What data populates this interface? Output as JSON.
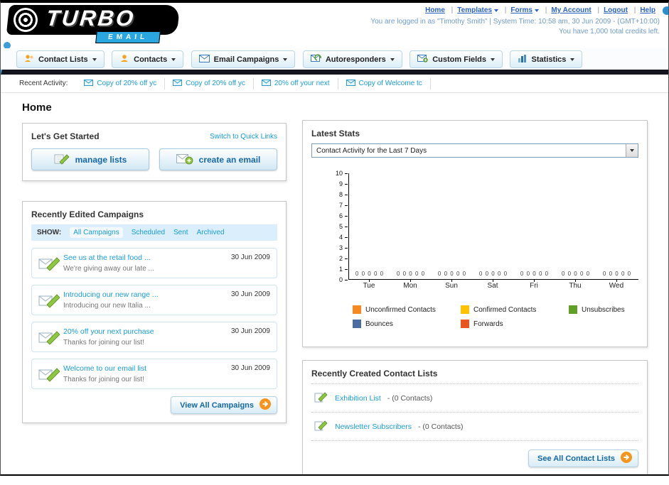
{
  "page_title": "Home",
  "header": {
    "logo_main": "TURBO",
    "logo_sub": "EMAIL",
    "top_links": [
      "Home",
      "Templates",
      "Forms",
      "My Account",
      "Logout",
      "Help"
    ],
    "login_info": "You are logged in as \"Timothy Smith\" | System Time: 10:58 am, 30 Jun 2009 - (GMT+10:00)",
    "credits_info": "You have 1,000 total credits left."
  },
  "nav": {
    "tabs": [
      {
        "label": "Contact Lists"
      },
      {
        "label": "Contacts"
      },
      {
        "label": "Email Campaigns"
      },
      {
        "label": "Autoresponders"
      },
      {
        "label": "Custom Fields"
      },
      {
        "label": "Statistics"
      }
    ]
  },
  "recent_activity": {
    "label": "Recent Activity:",
    "items": [
      "Copy of 20% off yc",
      "Copy of 20% off yc",
      "20% off your next",
      "Copy of Welcome tc"
    ]
  },
  "get_started": {
    "title": "Let's Get Started",
    "switch_link": "Switch to Quick Links",
    "buttons": [
      {
        "label": "manage lists"
      },
      {
        "label": "create an email"
      }
    ]
  },
  "campaigns": {
    "title": "Recently Edited Campaigns",
    "show_label": "SHOW:",
    "filters": [
      "All Campaigns",
      "Scheduled",
      "Sent",
      "Archived"
    ],
    "active_filter": "All Campaigns",
    "items": [
      {
        "title": "See us at the retail food ...",
        "subtitle": "We're giving away our late ...",
        "date": "30 Jun 2009"
      },
      {
        "title": "Introducing our new range ...",
        "subtitle": "Introducing our new Italia ...",
        "date": "30 Jun 2009"
      },
      {
        "title": "20% off your next purchase",
        "subtitle": "Thanks for joining our list!",
        "date": "30 Jun 2009"
      },
      {
        "title": "Welcome to our email list",
        "subtitle": "Thanks for joining our list!",
        "date": "30 Jun 2009"
      }
    ],
    "view_all_label": "View All Campaigns"
  },
  "latest_stats": {
    "title": "Latest Stats",
    "dropdown_value": "Contact Activity for the Last 7 Days",
    "chart_data": {
      "type": "bar",
      "title": "Contact Activity for the Last 7 Days",
      "categories": [
        "Tue",
        "Mon",
        "Sun",
        "Sat",
        "Fri",
        "Thu",
        "Wed"
      ],
      "series": [
        {
          "name": "Unconfirmed Contacts",
          "color": "#f6891f",
          "values": [
            0,
            0,
            0,
            0,
            0,
            0,
            0
          ]
        },
        {
          "name": "Confirmed Contacts",
          "color": "#fdc300",
          "values": [
            0,
            0,
            0,
            0,
            0,
            0,
            0
          ]
        },
        {
          "name": "Unsubscribes",
          "color": "#61a024",
          "values": [
            0,
            0,
            0,
            0,
            0,
            0,
            0
          ]
        },
        {
          "name": "Bounces",
          "color": "#4a6e9e",
          "values": [
            0,
            0,
            0,
            0,
            0,
            0,
            0
          ]
        },
        {
          "name": "Forwards",
          "color": "#e9541f",
          "values": [
            0,
            0,
            0,
            0,
            0,
            0,
            0
          ]
        }
      ],
      "ylim": [
        0,
        10
      ],
      "yticks_display": [
        "10",
        "9",
        "8",
        "7",
        "6",
        "5",
        "4",
        "3",
        "2",
        "1",
        "0"
      ],
      "zeros_display": "0 0 0 0 0",
      "grid": false,
      "legend_position": "bottom"
    }
  },
  "contact_lists": {
    "title": "Recently Created Contact Lists",
    "items": [
      {
        "name": "Exhibition List",
        "detail": "- (0 Contacts)"
      },
      {
        "name": "Newsletter Subscribers",
        "detail": "- (0 Contacts)"
      }
    ],
    "see_all_label": "See All Contact Lists"
  },
  "colors": {
    "teal_link": "#1a9cd8",
    "top_link_blue": "#2b62c4",
    "dark_bar": "#14141e",
    "button_text_blue": "#1668a6",
    "orange_arrow": "#f7941d"
  }
}
